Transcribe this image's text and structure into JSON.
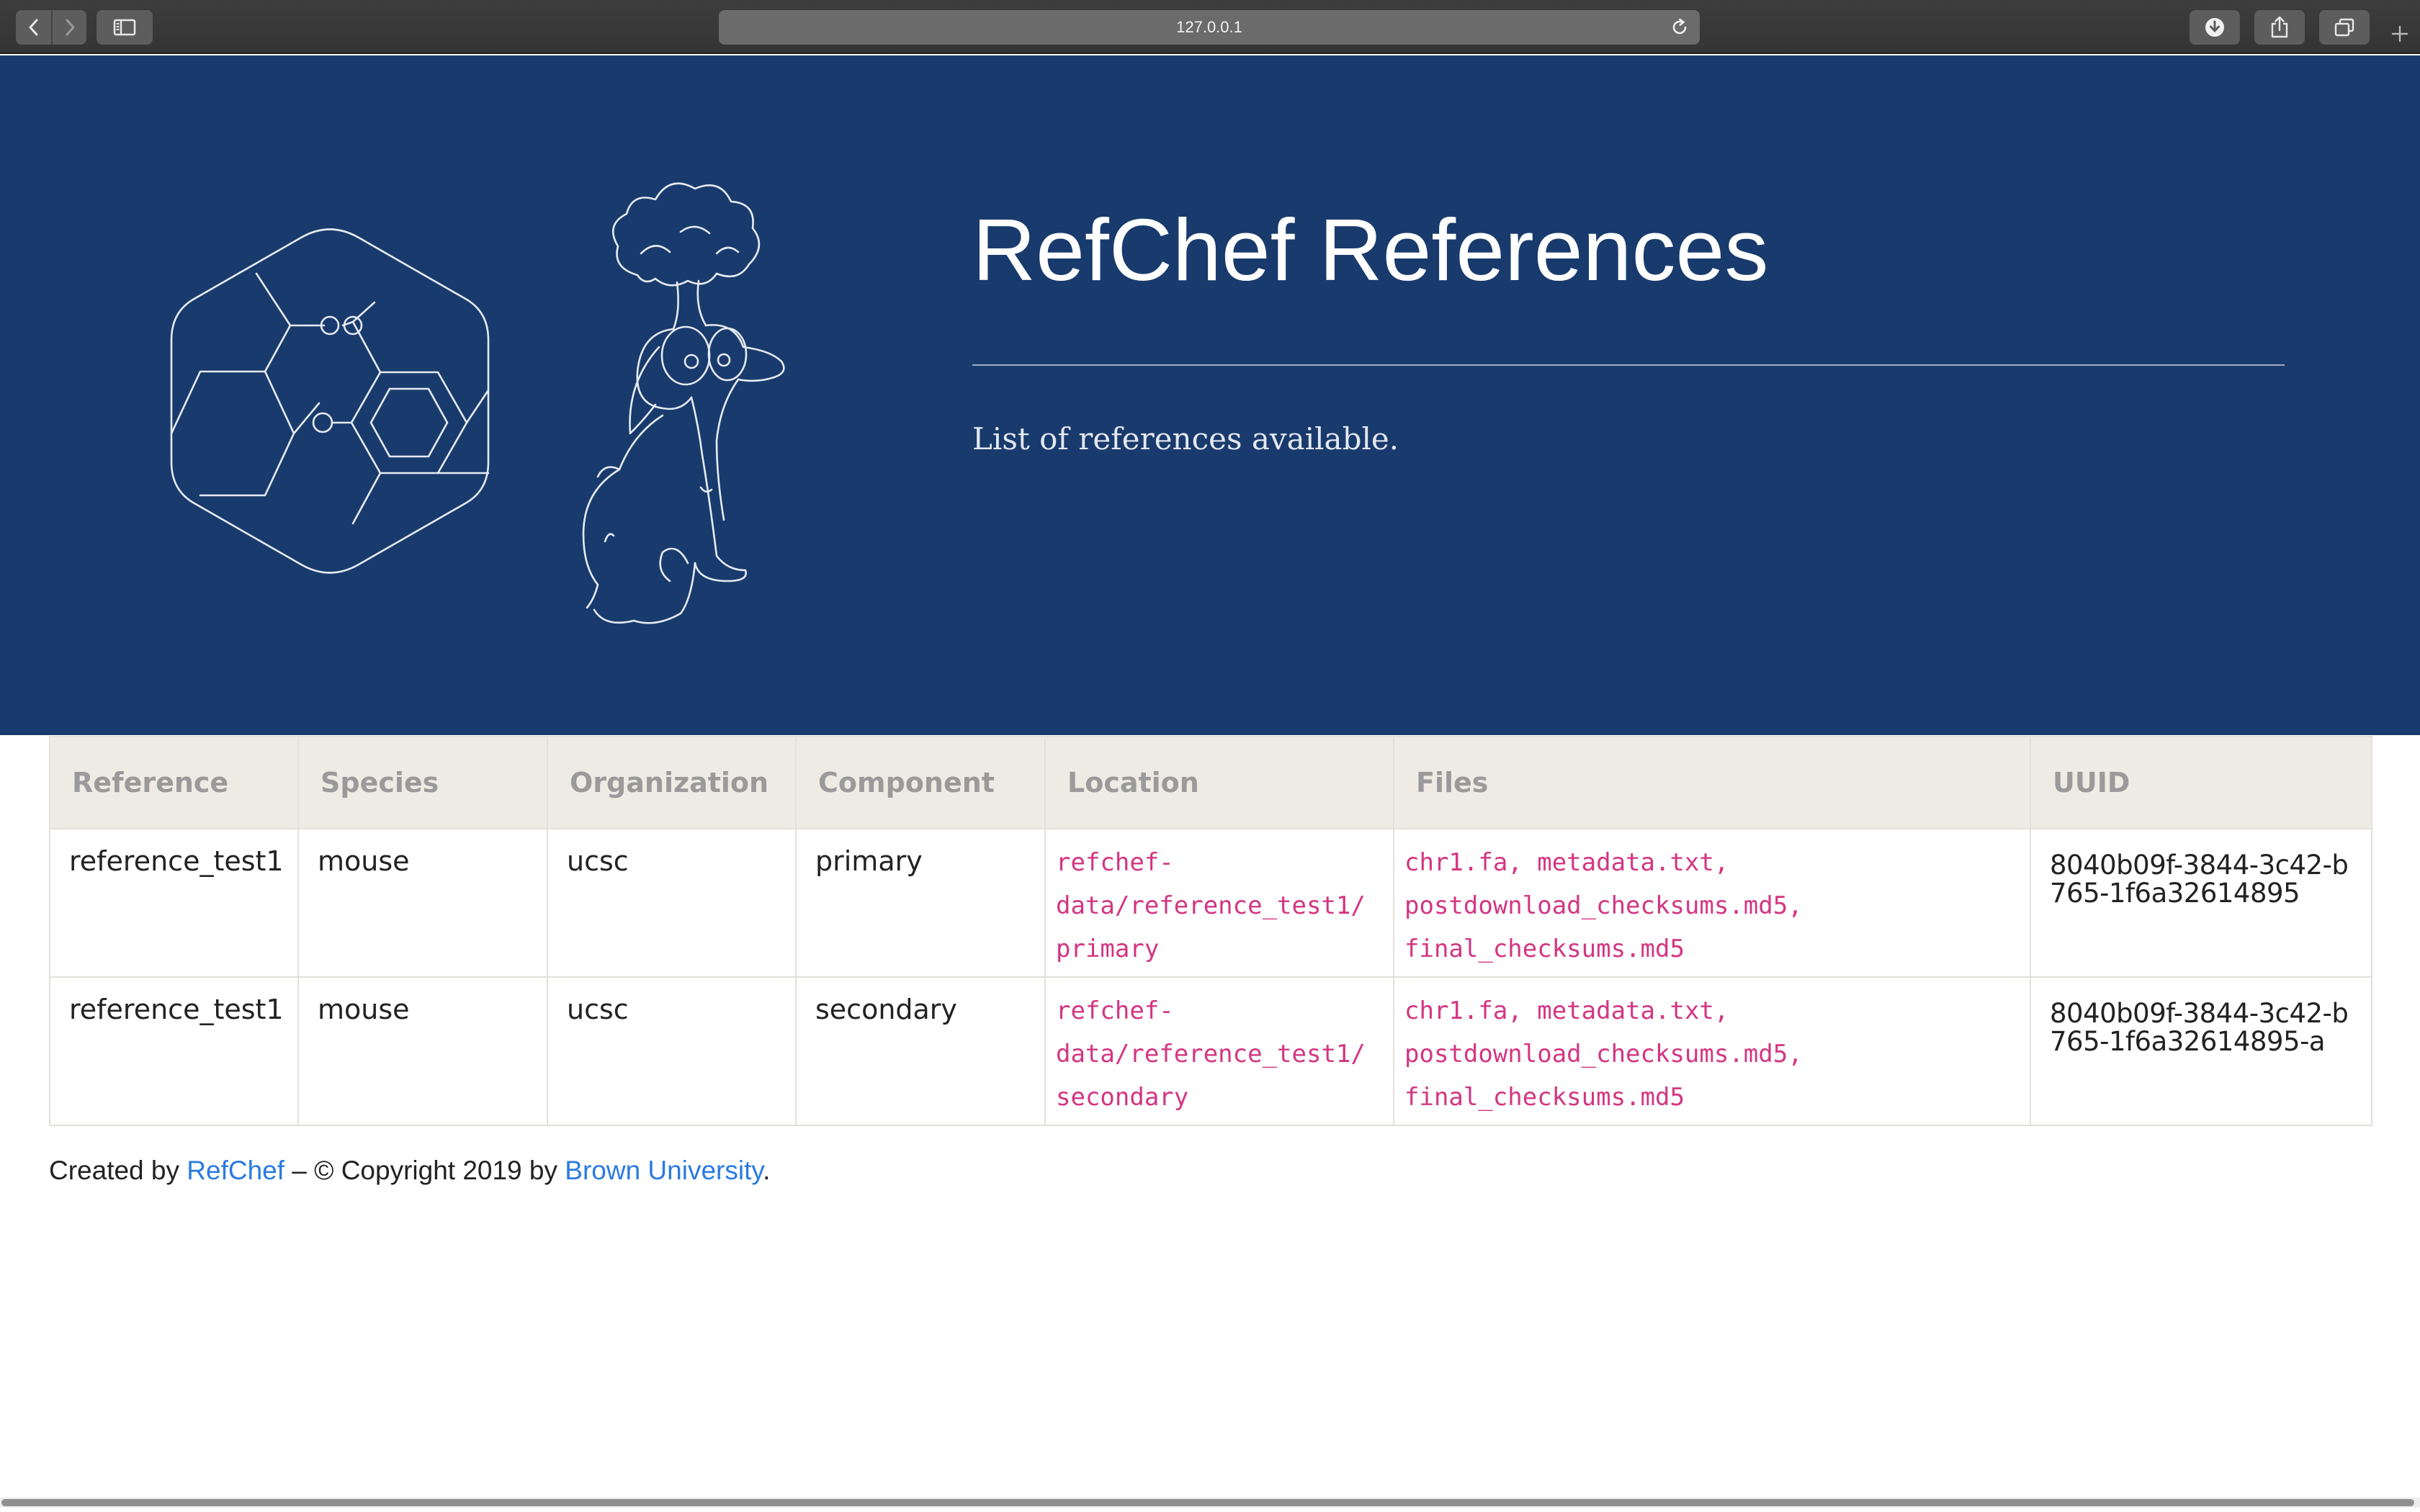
{
  "browser": {
    "url": "127.0.0.1",
    "back_icon": "chevron-left-icon",
    "forward_icon": "chevron-right-icon",
    "sidebar_icon": "sidebar-icon",
    "reload_icon": "reload-icon",
    "download_icon": "download-icon",
    "share_icon": "share-icon",
    "tabs_icon": "tabs-overview-icon",
    "new_tab_icon": "plus-icon"
  },
  "hero": {
    "title": "RefChef References",
    "lead": "List of references available.",
    "background_color": "#193a6c"
  },
  "table": {
    "columns": [
      "Reference",
      "Species",
      "Organization",
      "Component",
      "Location",
      "Files",
      "UUID"
    ],
    "rows": [
      {
        "reference": "reference_test1",
        "species": "mouse",
        "organization": "ucsc",
        "component": "primary",
        "location_lines": [
          "refchef-",
          "data/reference_test1/",
          "primary"
        ],
        "files_lines": [
          "chr1.fa, metadata.txt,",
          "postdownload_checksums.md5,",
          "final_checksums.md5"
        ],
        "uuid": "8040b09f-3844-3c42-b765-1f6a32614895"
      },
      {
        "reference": "reference_test1",
        "species": "mouse",
        "organization": "ucsc",
        "component": "secondary",
        "location_lines": [
          "refchef-",
          "data/reference_test1/",
          "secondary"
        ],
        "files_lines": [
          "chr1.fa, metadata.txt,",
          "postdownload_checksums.md5,",
          "final_checksums.md5"
        ],
        "uuid": "8040b09f-3844-3c42-b765-1f6a32614895-a"
      }
    ],
    "code_color": "#d33682"
  },
  "footer": {
    "prefix": "Created by ",
    "refchef_link": "RefChef",
    "middle": " – © Copyright 2019 by ",
    "brown_link": "Brown University",
    "suffix": ".",
    "link_color": "#2a7ae2"
  }
}
